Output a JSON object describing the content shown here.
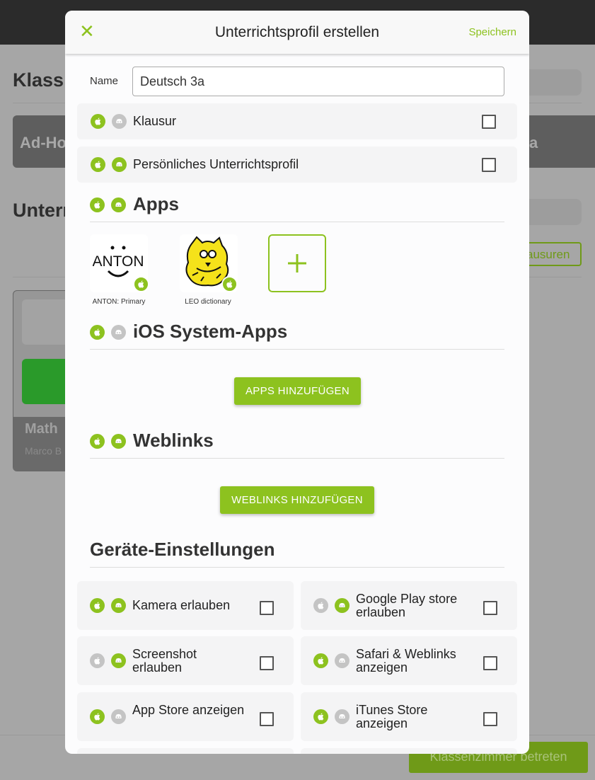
{
  "background": {
    "heading1": "Klass",
    "tile_left": "Ad-Ho",
    "tile_right": "a",
    "heading2": "Unterr",
    "outline_button": "ausuren",
    "card_title": "Math",
    "card_subtitle": "Marco B",
    "enter_button": "Klassenzimmer betreten"
  },
  "modal": {
    "title": "Unterrichtsprofil erstellen",
    "close_icon": "close-icon",
    "save_label": "Speichern",
    "name_label": "Name",
    "name_value": "Deutsch 3a",
    "options": [
      {
        "label": "Klausur",
        "ios": true,
        "android": false,
        "checked": false
      },
      {
        "label": "Persönliches Unterrichtsprofil",
        "ios": true,
        "android": true,
        "checked": false
      }
    ],
    "apps": {
      "heading": "Apps",
      "ios": true,
      "android": true,
      "items": [
        {
          "name": "ANTON: Primary",
          "platform": "ios"
        },
        {
          "name": "LEO dictionary",
          "platform": "ios"
        }
      ],
      "add_icon": "plus-icon"
    },
    "system_apps": {
      "heading": "iOS System-Apps",
      "ios": true,
      "android": false,
      "button": "APPS HINZUFÜGEN"
    },
    "weblinks": {
      "heading": "Weblinks",
      "ios": true,
      "android": true,
      "button": "WEBLINKS HINZUFÜGEN"
    },
    "device_settings": {
      "heading": "Geräte-Einstellungen",
      "items": [
        {
          "label": "Kamera erlauben",
          "ios": true,
          "android": true,
          "checked": false
        },
        {
          "label": "Google Play store erlauben",
          "ios": false,
          "android": true,
          "checked": false
        },
        {
          "label": "Screenshot erlauben",
          "ios": false,
          "android": true,
          "checked": false
        },
        {
          "label": "Safari & Weblinks anzeigen",
          "ios": true,
          "android": false,
          "checked": false
        },
        {
          "label": "App Store anzeigen",
          "ios": true,
          "android": false,
          "checked": false
        },
        {
          "label": "iTunes Store anzeigen",
          "ios": true,
          "android": false,
          "checked": false
        }
      ]
    }
  },
  "colors": {
    "accent": "#8dc21f",
    "inactive": "#c4c4c4"
  }
}
